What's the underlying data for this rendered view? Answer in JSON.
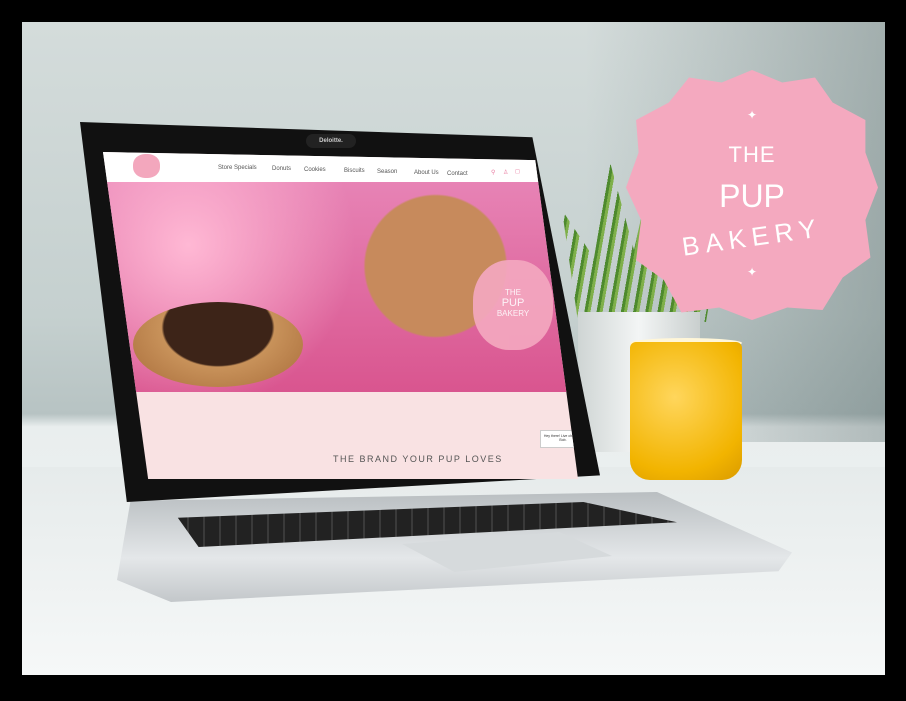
{
  "site": {
    "nav": [
      "Store Specials",
      "Donuts",
      "Cookies",
      "Biscuits",
      "Season",
      "About Us",
      "Contact"
    ],
    "tagline": "THE BRAND YOUR PUP LOVES",
    "chat_bubble": "Hey there! Live chat with Bob."
  },
  "laptop": {
    "camera_label": "Deloitte."
  },
  "badge": {
    "line1": "THE",
    "line2": "PUP",
    "line3": "BAKERY",
    "sparkle": "✦"
  },
  "colors": {
    "brand_pink": "#f4a9bf",
    "hero_pink": "#e26a9f"
  }
}
